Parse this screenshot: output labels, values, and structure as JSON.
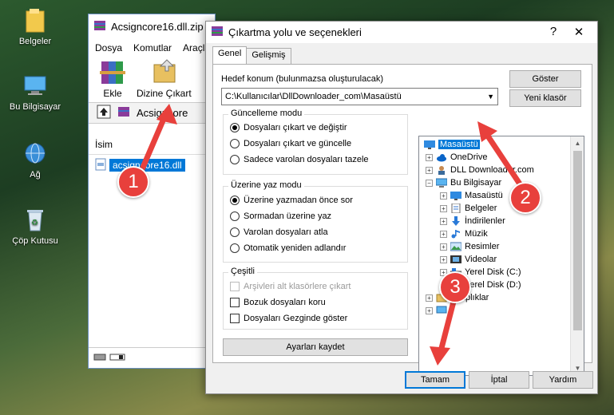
{
  "desktop": {
    "icons": [
      {
        "label": "Belgeler"
      },
      {
        "label": "Bu Bilgisayar"
      },
      {
        "label": "Ağ"
      },
      {
        "label": "Çöp Kutusu"
      }
    ]
  },
  "winrar": {
    "title": "Acsigncore16.dll.zip",
    "menu": [
      "Dosya",
      "Komutlar",
      "Araçla"
    ],
    "toolbar": {
      "extract_label": "Ekle",
      "extract_to_label": "Dizine Çıkart"
    },
    "path": "Acsigncore",
    "column_header": "İsim",
    "file_name": "acsigncore16.dll"
  },
  "dialog": {
    "title": "Çıkartma yolu ve seçenekleri",
    "help_btn": "?",
    "close_btn": "✕",
    "tabs": [
      "Genel",
      "Gelişmiş"
    ],
    "dest_label": "Hedef konum (bulunmazsa oluşturulacak)",
    "dest_value": "C:\\Kullanıcılar\\DllDownloader_com\\Masaüstü",
    "show_btn": "Göster",
    "new_folder_btn": "Yeni klasör",
    "update_mode": {
      "title": "Güncelleme modu",
      "options": [
        "Dosyaları çıkart ve değiştir",
        "Dosyaları çıkart ve güncelle",
        "Sadece varolan dosyaları tazele"
      ],
      "selected": 0
    },
    "overwrite_mode": {
      "title": "Üzerine yaz modu",
      "options": [
        "Üzerine yazmadan önce sor",
        "Sormadan üzerine yaz",
        "Varolan dosyaları atla",
        "Otomatik yeniden adlandır"
      ],
      "selected": 0
    },
    "misc": {
      "title": "Çeşitli",
      "options": [
        "Arşivleri alt klasörlere çıkart",
        "Bozuk dosyaları koru",
        "Dosyaları Gezginde göster"
      ]
    },
    "save_settings_btn": "Ayarları kaydet",
    "tree": [
      {
        "label": "Masaüstü",
        "level": 0,
        "selected": true,
        "icon": "desktop-icon"
      },
      {
        "label": "OneDrive",
        "level": 1,
        "icon": "cloud-icon"
      },
      {
        "label": "DLL Downloader.com",
        "level": 1,
        "icon": "user-icon"
      },
      {
        "label": "Bu Bilgisayar",
        "level": 1,
        "icon": "computer-icon"
      },
      {
        "label": "Masaüstü",
        "level": 2,
        "icon": "desktop-icon"
      },
      {
        "label": "Belgeler",
        "level": 2,
        "icon": "documents-icon"
      },
      {
        "label": "İndirilenler",
        "level": 2,
        "icon": "download-icon"
      },
      {
        "label": "Müzik",
        "level": 2,
        "icon": "music-icon"
      },
      {
        "label": "Resimler",
        "level": 2,
        "icon": "pictures-icon"
      },
      {
        "label": "Videolar",
        "level": 2,
        "icon": "video-icon"
      },
      {
        "label": "Yerel Disk (C:)",
        "level": 2,
        "icon": "drive-icon"
      },
      {
        "label": "Yerel Disk (D:)",
        "level": 2,
        "icon": "drive-icon"
      },
      {
        "label": "Kitaplıklar",
        "level": 1,
        "icon": "library-icon"
      },
      {
        "label": "",
        "level": 1,
        "icon": "network-icon"
      }
    ],
    "ok_btn": "Tamam",
    "cancel_btn": "İptal",
    "help_text_btn": "Yardım"
  },
  "markers": [
    "1",
    "2",
    "3"
  ]
}
